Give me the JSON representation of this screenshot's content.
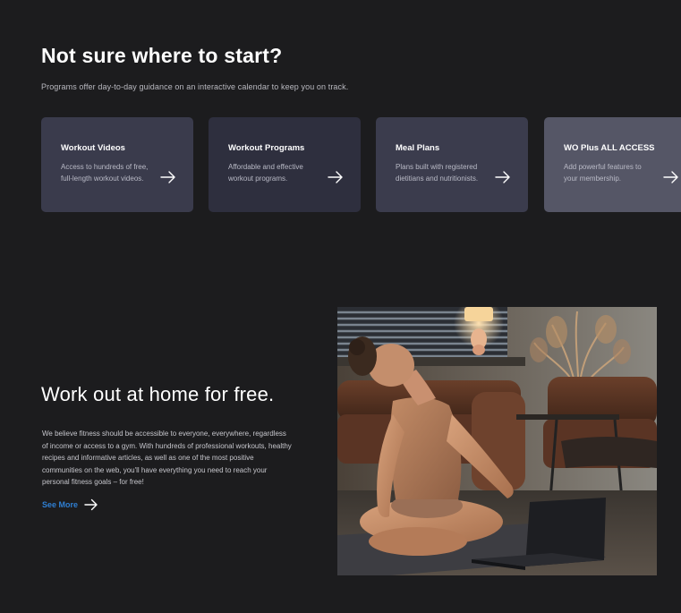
{
  "header": {
    "title": "Not sure where to start?",
    "subtitle": "Programs offer day-to-day guidance on an interactive calendar to keep you on track."
  },
  "cards": [
    {
      "title": "Workout Videos",
      "description": "Access to hundreds of free,\nfull-length workout videos.",
      "icon": "arrow-right-icon",
      "color": "#3a3b4c"
    },
    {
      "title": "Workout Programs",
      "description": "Affordable and effective\nworkout programs.",
      "icon": "arrow-right-icon",
      "color": "#2e2f3e"
    },
    {
      "title": "Meal Plans",
      "description": "Plans built with registered\ndietitians and nutritionists.",
      "icon": "arrow-right-icon",
      "color": "#3b3c4d"
    },
    {
      "title": "WO Plus ALL ACCESS",
      "description": "Add powerful features to\nyour membership.",
      "icon": "arrow-right-icon",
      "color": "#555666"
    }
  ],
  "section": {
    "title": "Work out at home for free.",
    "body": "We believe fitness should be accessible to everyone, everywhere, regardless of income or access to a gym. With hundreds of professional workouts, healthy recipes and informative articles, as well as one of the most positive communities on the web, you'll have everything you need to reach your personal fitness goals – for free!",
    "link_label": "See More",
    "link_icon": "arrow-right-icon",
    "link_color": "#2f7fd3",
    "image_icon": "yoga-photo"
  },
  "colors": {
    "background": "#1c1c1e",
    "text_primary": "#ffffff",
    "text_muted": "#b8b8bf"
  }
}
